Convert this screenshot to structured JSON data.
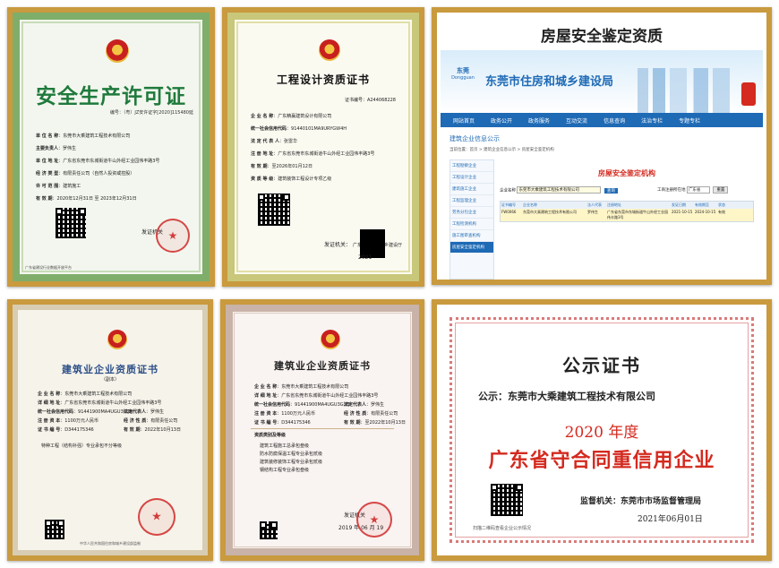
{
  "safety_cert": {
    "title": "安全生产许可证",
    "number": "编号：（粤）JZ安许证字[2020]115480延",
    "fields": [
      {
        "label": "单 位 名 称",
        "value": "东莞市大乘建筑工程技术有限公司"
      },
      {
        "label": "主要负责人",
        "value": "罗伟生"
      },
      {
        "label": "单 位 地 址",
        "value": "广东省东莞市东城街道牛山外经工业园伟丰路3号"
      },
      {
        "label": "经 济 类 型",
        "value": "有限责任公司（自然人投资或控股）"
      },
      {
        "label": "许 可 范 围",
        "value": "建筑施工"
      },
      {
        "label": "有 效 期",
        "value": "2020年12月31日 至 2023年12月31日"
      }
    ],
    "issuer": "发证机关",
    "footer": "广东省建设行业数据开放平台"
  },
  "design_cert": {
    "title": "工程设计资质证书",
    "number": "证书编号：A244068228",
    "fields": [
      {
        "label": "企 业 名 称",
        "value": "广东精赢建筑设计有限公司"
      },
      {
        "label": "统一社会信用代码",
        "value": "91440101MA9URYGW4H"
      },
      {
        "label": "法 定 代 表 人",
        "value": "张雷华"
      },
      {
        "label": "注 册 地 址",
        "value": "广东省东莞市东城街道牛山外经工业园伟丰路3号"
      },
      {
        "label": "有 效 期",
        "value": "至2026年01月12日"
      },
      {
        "label": "资 质 等 级",
        "value": "建筑装饰工程设计专项乙级"
      }
    ],
    "issuer": "发证机关：",
    "issuer_value": "广东省住房和城乡建设厅",
    "date": "2021"
  },
  "appraisal": {
    "heading": "房屋安全鉴定资质",
    "brand_small": "东莞",
    "brand_pinyin": "Dongguan",
    "bureau": "东莞市住房和城乡建设局",
    "nav": [
      "网站首页",
      "政务公开",
      "政务服务",
      "互动交流",
      "信息查询",
      "法治专栏",
      "专题专栏"
    ],
    "section": "建筑企业信息公示",
    "breadcrumb": "当前位置：首页 > 建筑企业信息公示 > 房屋安全鉴定机构",
    "sidebar": [
      "工程勘察企业",
      "工程设计企业",
      "建筑施工企业",
      "工程监理企业",
      "劳务分包企业",
      "工程检测机构",
      "施工图审查机构",
      "房屋安全鉴定机构"
    ],
    "panel_title": "房屋安全鉴定机构",
    "search_label": "企业名称",
    "search_value": "东莞市大乘建筑工程技术有限公司",
    "search_button": "查询",
    "region_label": "工商注册所在地",
    "region_value": "广东省",
    "reset_button": "重置",
    "table_headers": [
      "证书编号",
      "企业名称",
      "法人代表",
      "注册地址",
      "发证日期",
      "有效期至",
      "状态"
    ],
    "row": [
      "FW0066",
      "东莞市大乘建筑工程技术有限公司",
      "罗伟生",
      "广东省东莞市东城街道牛山外经工业园伟丰路3号",
      "2021-10-15",
      "2024-10-15",
      "有效"
    ]
  },
  "qual_copy": {
    "title": "建筑业企业资质证书",
    "subtitle": "（副本）",
    "fields": [
      {
        "label": "企 业 名 称",
        "value": "东莞市大乘建筑工程技术有限公司"
      },
      {
        "label": "详 细 地 址",
        "value": "广东省东莞市东城街道牛山外经工业园伟丰路3号"
      },
      {
        "label": "统一社会信用代码",
        "value": "91441900MA4UGU3G2B"
      },
      {
        "label": "注 册 资 本",
        "value": "1100万元人民币"
      },
      {
        "label": "证 书 编 号",
        "value": "D344175346"
      }
    ],
    "extra": [
      {
        "label": "法定代表人",
        "value": "罗伟生"
      },
      {
        "label": "经 济 性 质",
        "value": "有限责任公司"
      },
      {
        "label": "有 效 期",
        "value": "2022年10月13日"
      }
    ],
    "scope": "特种工程（结构补强）专业承包不分等级",
    "footer": "中华人民共和国住房和城乡建设部监制"
  },
  "qual_main": {
    "title": "建筑业企业资质证书",
    "fields": [
      {
        "label": "企 业 名 称",
        "value": "东莞市大乘建筑工程技术有限公司"
      },
      {
        "label": "详 细 地 址",
        "value": "广东省东莞市东城街道牛山外经工业园伟丰路3号"
      },
      {
        "label": "统一社会信用代码",
        "value": "91441900MA4UGU3G2B"
      },
      {
        "label": "注 册 资 本",
        "value": "1100万元人民币"
      },
      {
        "label": "证 书 编 号",
        "value": "D344175346"
      }
    ],
    "extra": [
      {
        "label": "法定代表人",
        "value": "罗伟生"
      },
      {
        "label": "经 济 性 质",
        "value": "有限责任公司"
      },
      {
        "label": "有 效 期",
        "value": "至2022年10月13日"
      }
    ],
    "scope_title": "资质类别及等级",
    "scope": [
      "建筑工程施工总承包叁级",
      "防水防腐保温工程专业承包贰级",
      "建筑装修装饰工程专业承包贰级",
      "钢结构工程专业承包叁级"
    ],
    "issuer": "发证机关",
    "date": "2019 年 06 月 19"
  },
  "notice": {
    "title": "公示证书",
    "prefix": "公示：",
    "company": "东莞市大乘建筑工程技术有限公司",
    "year": "2020 年度",
    "award": "广东省守合同重信用企业",
    "supervisor_label": "监督机关：",
    "supervisor": "东莞市市场监督管理局",
    "date": "2021年06月01日",
    "scan": "扫描二维码查看企业公示情况"
  },
  "colors": {
    "gold_frame": "#c99a3e",
    "red": "#d42a1f",
    "safety_green": "#1f7a3c",
    "site_blue": "#1e6ab5"
  }
}
